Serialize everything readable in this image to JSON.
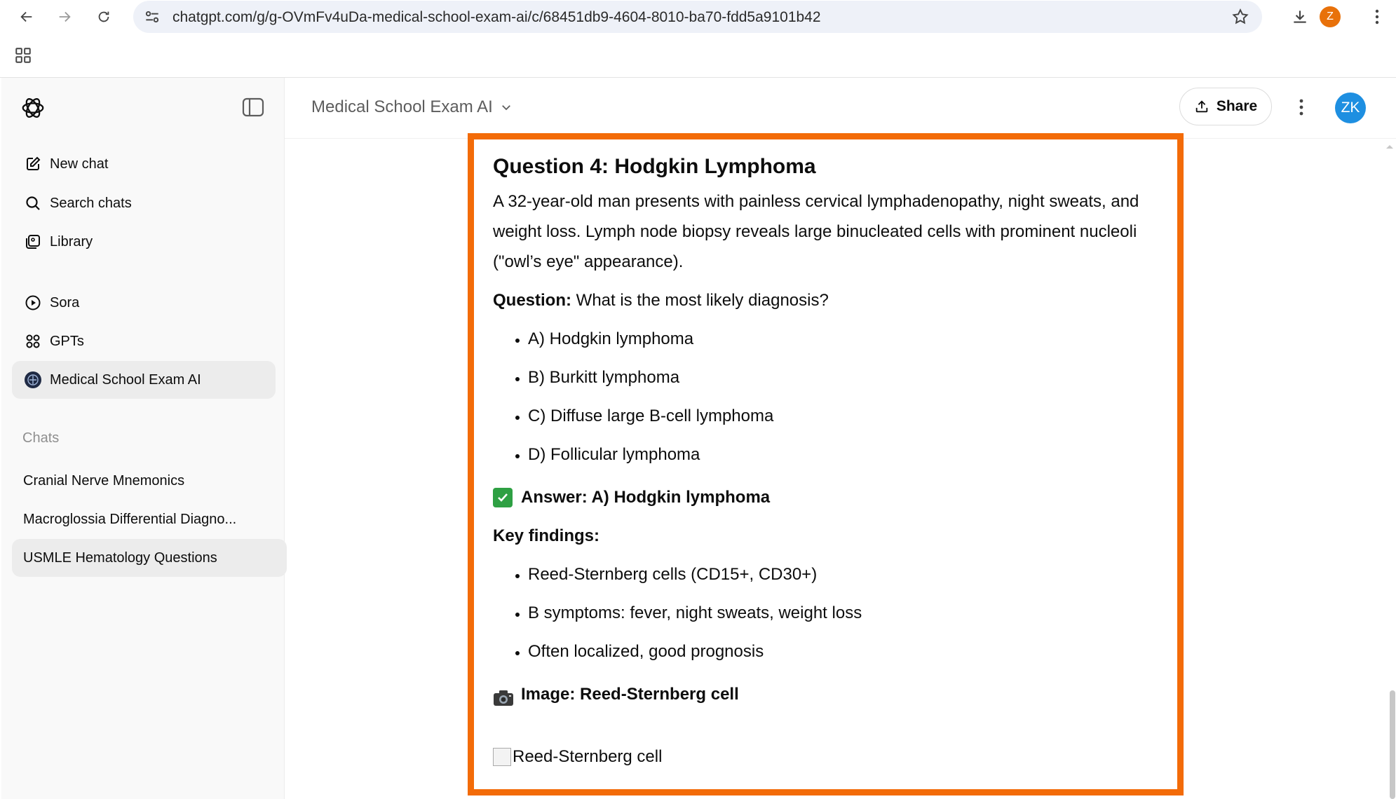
{
  "browser": {
    "url": "chatgpt.com/g/g-OVmFv4uDa-medical-school-exam-ai/c/68451db9-4604-8010-ba70-fdd5a9101b42",
    "profile_initial": "Z"
  },
  "sidebar": {
    "nav": [
      {
        "label": "New chat",
        "icon": "new-chat-icon"
      },
      {
        "label": "Search chats",
        "icon": "search-icon"
      },
      {
        "label": "Library",
        "icon": "library-icon"
      }
    ],
    "explore": [
      {
        "label": "Sora",
        "icon": "play-circle-icon"
      },
      {
        "label": "GPTs",
        "icon": "grid-icon"
      },
      {
        "label": "Medical School Exam AI",
        "icon": "gpt-avatar-icon",
        "active": true
      }
    ],
    "chats_label": "Chats",
    "chats": [
      {
        "label": "Cranial Nerve Mnemonics"
      },
      {
        "label": "Macroglossia Differential Diagno..."
      },
      {
        "label": "USMLE Hematology Questions",
        "active": true
      }
    ]
  },
  "header": {
    "title": "Medical School Exam AI",
    "share_label": "Share",
    "avatar_initials": "ZK"
  },
  "message": {
    "heading": "Question 4: Hodgkin Lymphoma",
    "vignette": "A 32-year-old man presents with painless cervical lymphadenopathy, night sweats, and weight loss. Lymph node biopsy reveals large binucleated cells with prominent nucleoli (\"owl’s eye\" appearance).",
    "question_label": "Question:",
    "question_text": " What is the most likely diagnosis?",
    "options": [
      "A) Hodgkin lymphoma",
      "B) Burkitt lymphoma",
      "C) Diffuse large B-cell lymphoma",
      "D) Follicular lymphoma"
    ],
    "answer": "Answer: A) Hodgkin lymphoma",
    "key_findings_label": "Key findings:",
    "key_findings": [
      "Reed-Sternberg cells (CD15+, CD30+)",
      "B symptoms: fever, night sweats, weight loss",
      "Often localized, good prognosis"
    ],
    "image_label": "Image: Reed-Sternberg cell",
    "image_alt": "Reed-Sternberg cell"
  },
  "colors": {
    "highlight": "#f36b08",
    "avatar": "#1e8fe1",
    "profile": "#e8710a",
    "check": "#2ea043"
  }
}
